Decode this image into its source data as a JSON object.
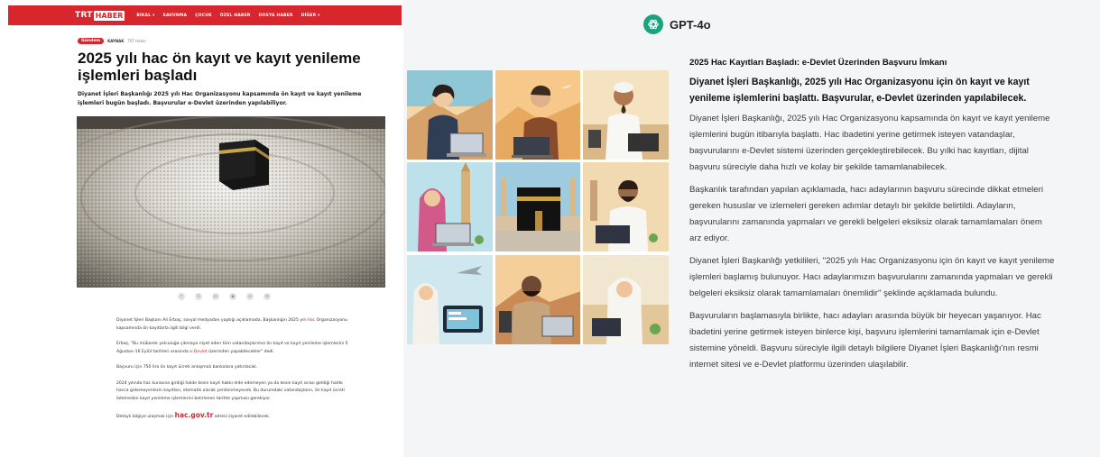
{
  "left_article": {
    "logo_trt": "TRT",
    "logo_haber": "HABER",
    "nav": [
      "BİKAL ▾",
      "SAVUNMA",
      "ÇOCUK",
      "ÖZEL HABER",
      "DOSYA HABER",
      "DİĞER ▾"
    ],
    "badge": "Gündem",
    "source_label": "KAYNAK",
    "source_value": "TRT Haber",
    "headline": "2025 yılı hac ön kayıt ve kayıt yenileme işlemleri başladı",
    "summary": "Diyanet İşleri Başkanlığı 2025 yılı Hac Organizasyonu kapsamında ön kayıt ve kayıt yenileme işlemleri bugün başladı. Başvurular e-Devlet üzerinden yapılabiliyor.",
    "share_icons": [
      "f",
      "𝕏",
      "in",
      "◉",
      "⊙",
      "✉"
    ],
    "p1_before": "Diyanet İşleri Başkanı Ali Erbaş, sosyal medyadan yaptığı açıklamada, Başkanlığın 2025 yılı ",
    "p1_link": "Hac",
    "p1_after": " Organizasyonu kapsamında ön kayıtlarla ilgili bilgi verdi.",
    "p2_before": "Erbaş, \"Bu mübarek yolculuğa çıkmaya niyet eden tüm vatandaşlarımız ön kayıt ve kayıt yenileme işlemlerini 5 Ağustos–16 Eylül tarihleri arasında ",
    "p2_link": "e-Devlet",
    "p2_after": " üzerinden yapabilecekler\" dedi.",
    "p3": "Başvuru için 750 lira ön kayıt ücreti anlaşmalı bankalara yatırılacak.",
    "p4": "2024 yılında hac kurasına girdiği halde kesin kayıt hakkı elde edemeyen ya da kesin kayıt sırası geldiği halde hacca gidemeyenlerin kayıtları, otomatik olarak yenilenmeyecek. Bu durumdaki vatandaşların, ön kayıt ücreti ödemeden kayıt yenileme işlemlerini belirlenen tarihte yapması gerekiyor.",
    "p5_before": "Detaylı bilgiye ulaşmak için ",
    "p5_link": "hac.gov.tr",
    "p5_after": " adresi ziyaret edilebilecek."
  },
  "gpt": {
    "model_name": "GPT-4o",
    "title": "2025 Hac Kayıtları Başladı: e-Devlet Üzerinden Başvuru İmkanı",
    "lead": "Diyanet İşleri Başkanlığı, 2025 yılı Hac Organizasyonu için ön kayıt ve kayıt yenileme işlemlerini başlattı. Başvurular, e-Devlet üzerinden yapılabilecek.",
    "p1": "Diyanet İşleri Başkanlığı, 2025 yılı Hac Organizasyonu kapsamında ön kayıt ve kayıt yenileme işlemlerini bugün itibarıyla başlattı. Hac ibadetini yerine getirmek isteyen vatandaşlar, başvurularını e-Devlet sistemi üzerinden gerçekleştirebilecek. Bu yılki hac kayıtları, dijital başvuru süreciyle daha hızlı ve kolay bir şekilde tamamlanabilecek.",
    "p2": "Başkanlık tarafından yapılan açıklamada, hacı adaylarının başvuru sürecinde dikkat etmeleri gereken hususlar ve izlemeleri gereken adımlar detaylı bir şekilde belirtildi. Adayların, başvurularını zamanında yapmaları ve gerekli belgeleri eksiksiz olarak tamamlamaları önem arz ediyor.",
    "p3": "Diyanet İşleri Başkanlığı yetkilileri, \"2025 yılı Hac Organizasyonu için ön kayıt ve kayıt yenileme işlemleri başlamış bulunuyor. Hacı adaylarımızın başvurularını zamanında yapmaları ve gerekli belgeleri eksiksiz olarak tamamlamaları önemlidir\" şeklinde açıklamada bulundu.",
    "p4": "Başvuruların başlamasıyla birlikte, hacı adayları arasında büyük bir heyecan yaşanıyor. Hac ibadetini yerine getirmek isteyen binlerce kişi, başvuru işlemlerini tamamlamak için e-Devlet sistemine yöneldi. Başvuru süreciyle ilgili detaylı bilgilere Diyanet İşleri Başkanlığı'nın resmi internet sitesi ve e-Devlet platformu üzerinden ulaşılabilir."
  },
  "colors": {
    "trt_red": "#d7262e",
    "gpt_green": "#1aa37f",
    "panel_bg": "#f4f5f7"
  }
}
